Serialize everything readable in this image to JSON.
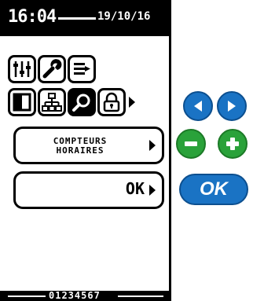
{
  "status": {
    "time": "16:04",
    "date": "19/10/16",
    "serial": "01234567"
  },
  "toolbar_icons": [
    {
      "name": "settings-sliders-icon"
    },
    {
      "name": "wrench-icon"
    },
    {
      "name": "list-arrow-icon"
    }
  ],
  "mode_icons": [
    {
      "name": "panel-icon"
    },
    {
      "name": "network-icon"
    },
    {
      "name": "search-icon",
      "selected": true
    },
    {
      "name": "lock-icon"
    }
  ],
  "menu": {
    "item_label": "COMPTEURS\nHORAIRES",
    "ok_label": "OK"
  },
  "controls": {
    "ok_button": "OK"
  },
  "colors": {
    "accent_blue": "#1a73c4",
    "accent_green": "#2aa23a"
  }
}
